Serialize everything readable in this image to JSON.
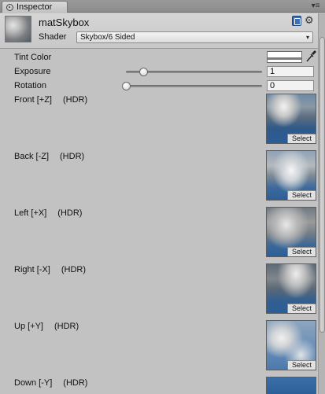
{
  "window": {
    "tab_title": "Inspector",
    "tab_menu": "▾≡"
  },
  "header": {
    "material_name": "matSkybox",
    "shader_label": "Shader",
    "shader_value": "Skybox/6 Sided",
    "dropdown_arrow": "▾",
    "gear_glyph": "⚙"
  },
  "properties": {
    "tint": {
      "label": "Tint Color",
      "color": "#ffffff"
    },
    "exposure": {
      "label": "Exposure",
      "value": "1",
      "slider_fraction": 0.13
    },
    "rotation": {
      "label": "Rotation",
      "value": "0",
      "slider_fraction": 0.0
    }
  },
  "textures": [
    {
      "label": "Front [+Z]",
      "hdr": "(HDR)",
      "select": "Select",
      "visual": "skybox-cloud-texture"
    },
    {
      "label": "Back [-Z]",
      "hdr": "(HDR)",
      "select": "Select",
      "visual": "skybox-cloud-texture"
    },
    {
      "label": "Left [+X]",
      "hdr": "(HDR)",
      "select": "Select",
      "visual": "skybox-cloud-texture"
    },
    {
      "label": "Right [-X]",
      "hdr": "(HDR)",
      "select": "Select",
      "visual": "skybox-cloud-texture"
    },
    {
      "label": "Up [+Y]",
      "hdr": "(HDR)",
      "select": "Select",
      "visual": "skybox-cloud-texture"
    },
    {
      "label": "Down [-Y]",
      "hdr": "(HDR)",
      "select": "",
      "visual": "skybox-cloud-texture"
    }
  ],
  "icons": {
    "tab": "inspector-info-icon",
    "help": "help-book-icon",
    "settings": "gear-icon",
    "eyedropper": "eyedropper-icon",
    "material_preview": "material-preview-thumbnail"
  },
  "colors": {
    "panel_bg": "#c2c2c2",
    "accent_blue": "#3d6fb6"
  }
}
